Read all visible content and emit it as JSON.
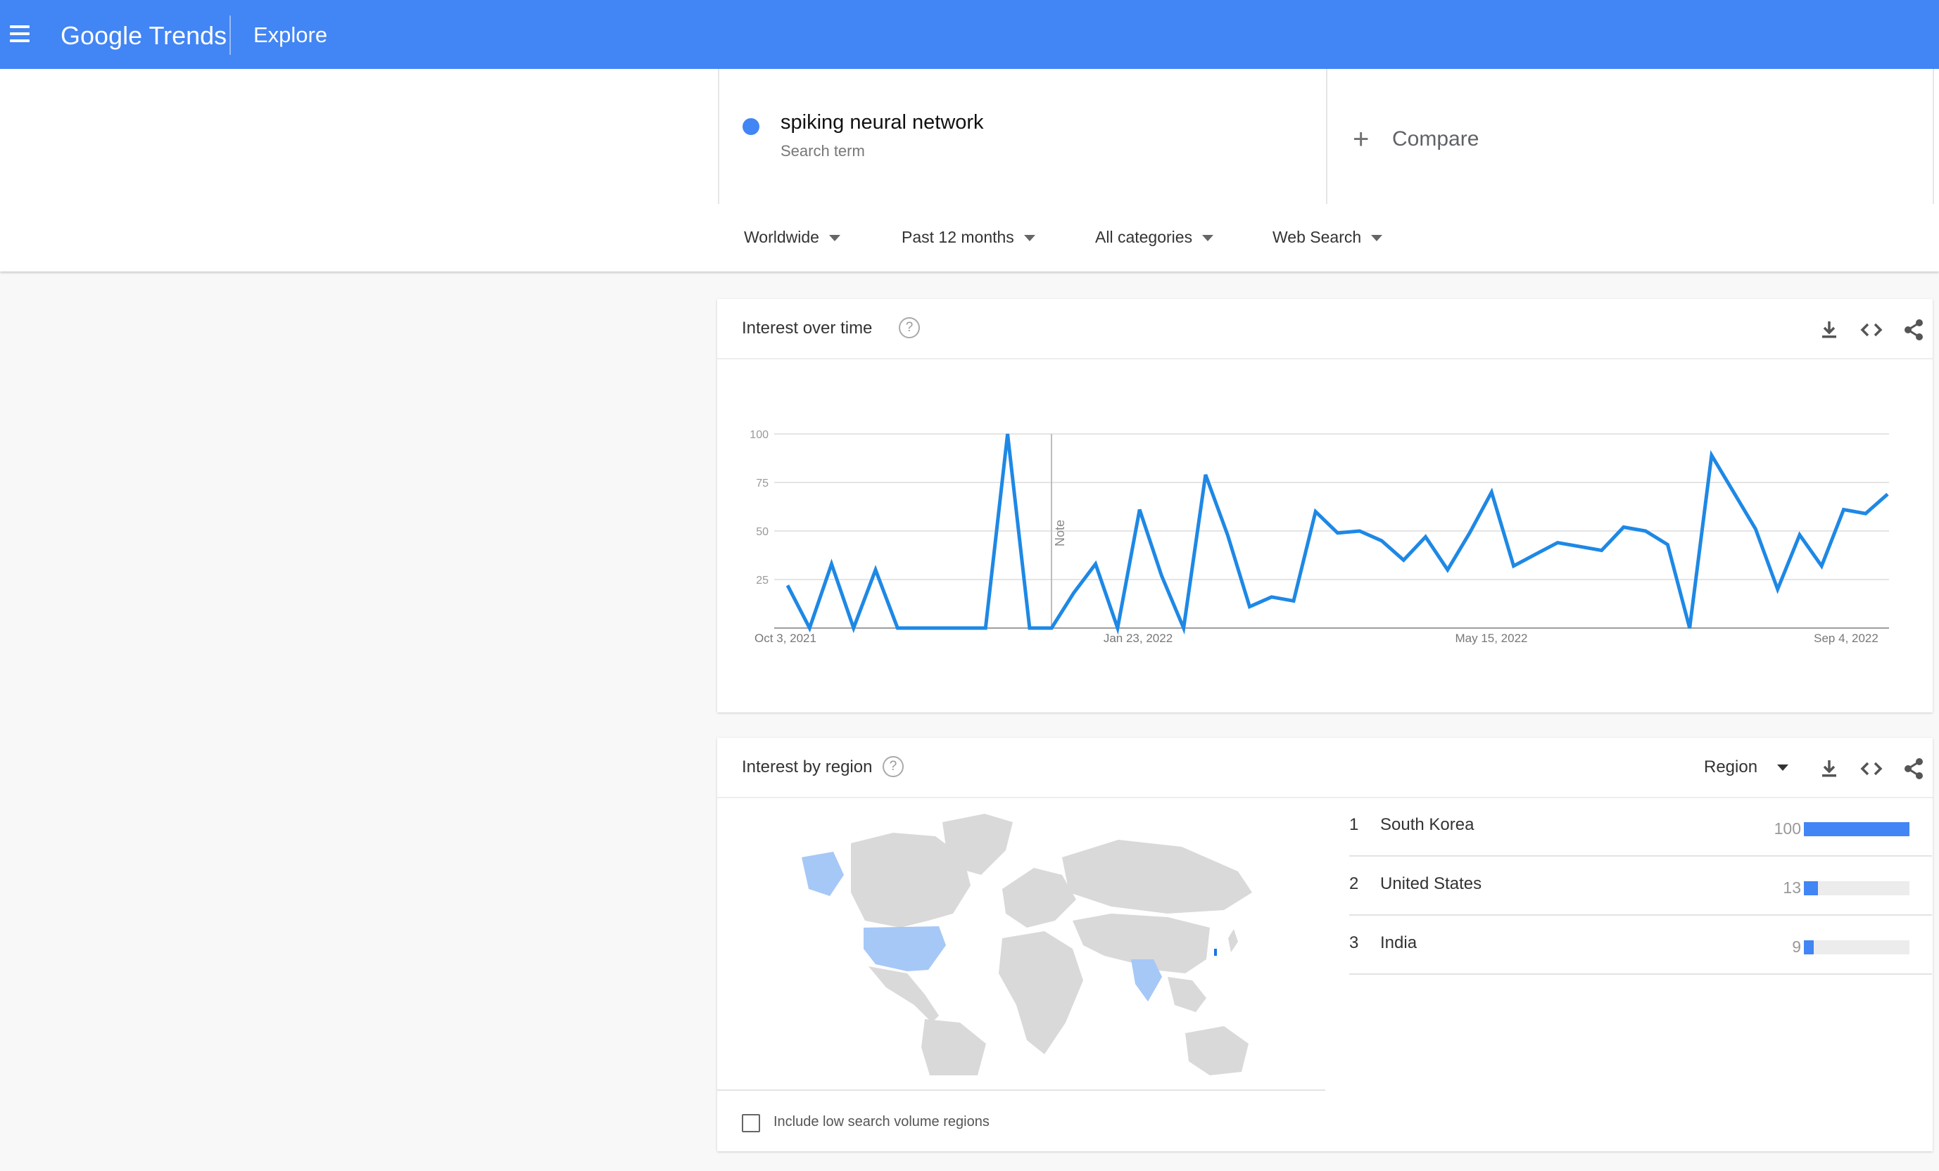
{
  "header": {
    "logo_text": "Google Trends",
    "nav_title": "Explore"
  },
  "search": {
    "term": "spiking neural network",
    "term_subtitle": "Search term",
    "term_color": "#4285f4",
    "compare_label": "Compare"
  },
  "filters": {
    "location": "Worldwide",
    "time_range": "Past 12 months",
    "category": "All categories",
    "search_type": "Web Search"
  },
  "interest_over_time": {
    "title": "Interest over time",
    "note_label": "Note",
    "chart_data": {
      "type": "line",
      "x_tick_labels": [
        "Oct 3, 2021",
        "Jan 23, 2022",
        "May 15, 2022",
        "Sep 4, 2022"
      ],
      "y_tick_labels": [
        "100",
        "75",
        "50",
        "25"
      ],
      "ylim": [
        0,
        100
      ],
      "grid": true,
      "series": [
        {
          "name": "spiking neural network",
          "color": "#1e88e5",
          "values": [
            22,
            0,
            33,
            0,
            30,
            0,
            0,
            0,
            0,
            0,
            100,
            0,
            0,
            18,
            33,
            0,
            61,
            27,
            0,
            79,
            48,
            11,
            16,
            14,
            60,
            49,
            50,
            45,
            35,
            47,
            30,
            49,
            70,
            32,
            38,
            44,
            42,
            40,
            52,
            50,
            43,
            0,
            89,
            70,
            51,
            20,
            48,
            32,
            61,
            59,
            69
          ]
        }
      ]
    }
  },
  "interest_by_region": {
    "title": "Interest by region",
    "resolution": "Region",
    "regions": [
      {
        "rank": "1",
        "name": "South Korea",
        "value": 100
      },
      {
        "rank": "2",
        "name": "United States",
        "value": 13
      },
      {
        "rank": "3",
        "name": "India",
        "value": 9
      }
    ],
    "map_highlight_color": "#a5c8f7",
    "map_base_color": "#d9d9d9",
    "low_volume_label": "Include low search volume regions"
  }
}
